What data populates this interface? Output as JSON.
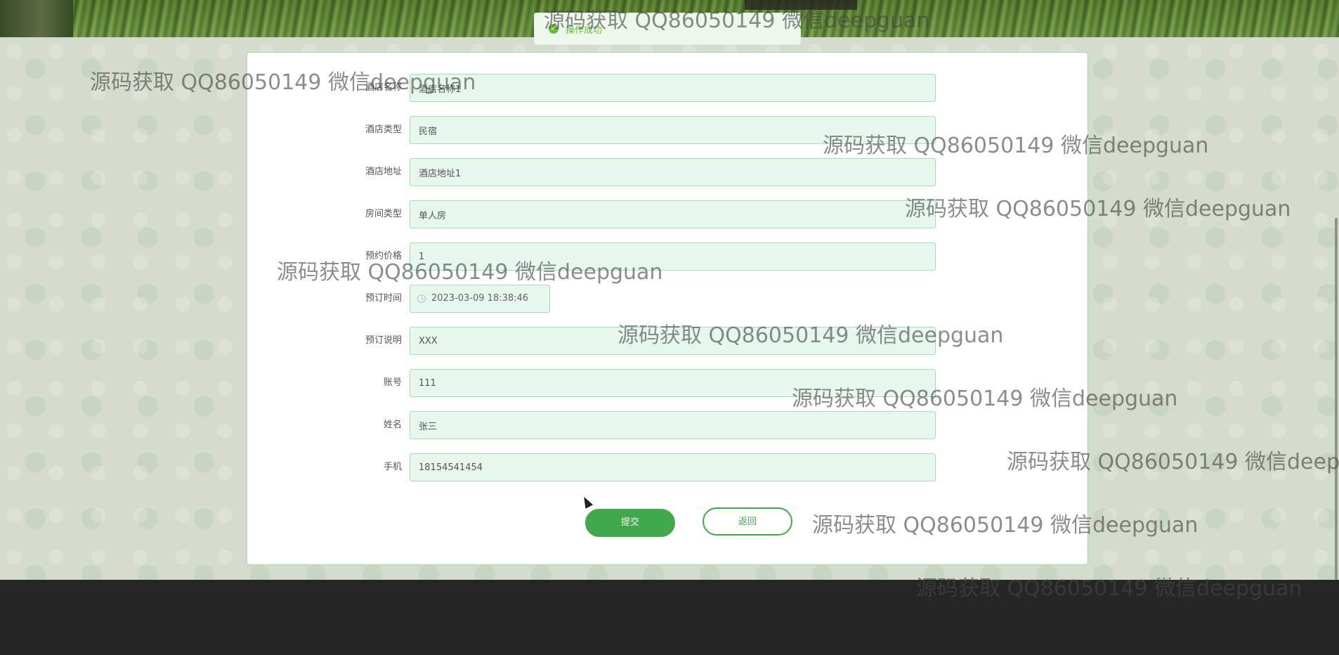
{
  "toast": {
    "text": "操作成功"
  },
  "form": {
    "fields": [
      {
        "label": "酒店名称",
        "value": "酒店名称1"
      },
      {
        "label": "酒店类型",
        "value": "民宿"
      },
      {
        "label": "酒店地址",
        "value": "酒店地址1"
      },
      {
        "label": "房间类型",
        "value": "单人房"
      },
      {
        "label": "预约价格",
        "value": "1"
      },
      {
        "label": "预订时间",
        "value": "2023-03-09 18:38:46"
      },
      {
        "label": "预订说明",
        "value": "XXX"
      },
      {
        "label": "账号",
        "value": "111"
      },
      {
        "label": "姓名",
        "value": "张三"
      },
      {
        "label": "手机",
        "value": "18154541454"
      }
    ],
    "submit_label": "提交",
    "back_label": "返回"
  },
  "watermark": {
    "text": "源码获取 QQ86050149 微信deepguan"
  },
  "colors": {
    "accent": "#3fa94b",
    "field_bg": "#e6f7ec",
    "footer": "#262626"
  }
}
